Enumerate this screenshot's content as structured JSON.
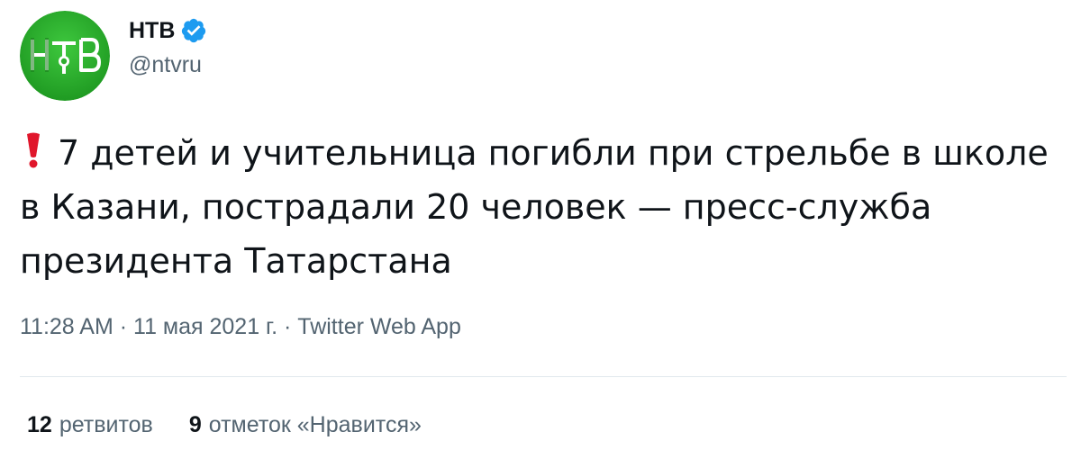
{
  "author": {
    "display_name": "НТВ",
    "handle": "@ntvru",
    "avatar_icon": "ntv-logo-icon",
    "verified_icon": "verified-badge-icon",
    "verified_color": "#1d9bf0"
  },
  "tweet": {
    "alert_icon": "red-exclamation-icon",
    "text": "7 детей и учительница погибли при стрельбе в школе в Казани, пострадали 20 человек — пресс-служба президента Татарстана"
  },
  "meta": {
    "time": "11:28 AM",
    "separator": "·",
    "date": "11 мая 2021 г.",
    "source": "Twitter Web App"
  },
  "stats": {
    "retweets_count": "12",
    "retweets_label": "ретвитов",
    "likes_count": "9",
    "likes_label": "отметок «Нравится»"
  },
  "colors": {
    "text_primary": "#0f1419",
    "text_secondary": "#536471",
    "avatar_green": "#2fae2f",
    "alert_red": "#e0162b"
  }
}
